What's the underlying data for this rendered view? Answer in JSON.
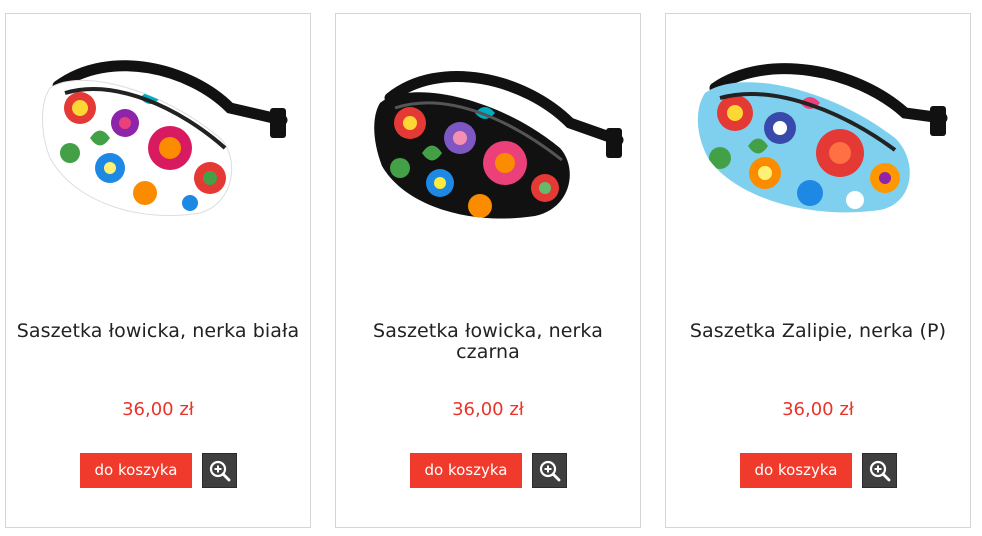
{
  "products": [
    {
      "title": "Saszetka łowicka, nerka biała",
      "price": "36,00 zł",
      "cart_label": "do koszyka",
      "image_icon": "fanny-pack-white-floral",
      "bag_color": "#ffffff"
    },
    {
      "title": "Saszetka łowicka, nerka czarna",
      "price": "36,00 zł",
      "cart_label": "do koszyka",
      "image_icon": "fanny-pack-black-floral",
      "bag_color": "#111111"
    },
    {
      "title": "Saszetka Zalipie, nerka (P)",
      "price": "36,00 zł",
      "cart_label": "do koszyka",
      "image_icon": "fanny-pack-blue-floral",
      "bag_color": "#7fd0ee"
    }
  ],
  "colors": {
    "accent_red": "#f03a2c",
    "price_red": "#e8352b",
    "zoom_bg": "#3f3f3f"
  },
  "icons": {
    "zoom": "zoom-in-icon"
  }
}
